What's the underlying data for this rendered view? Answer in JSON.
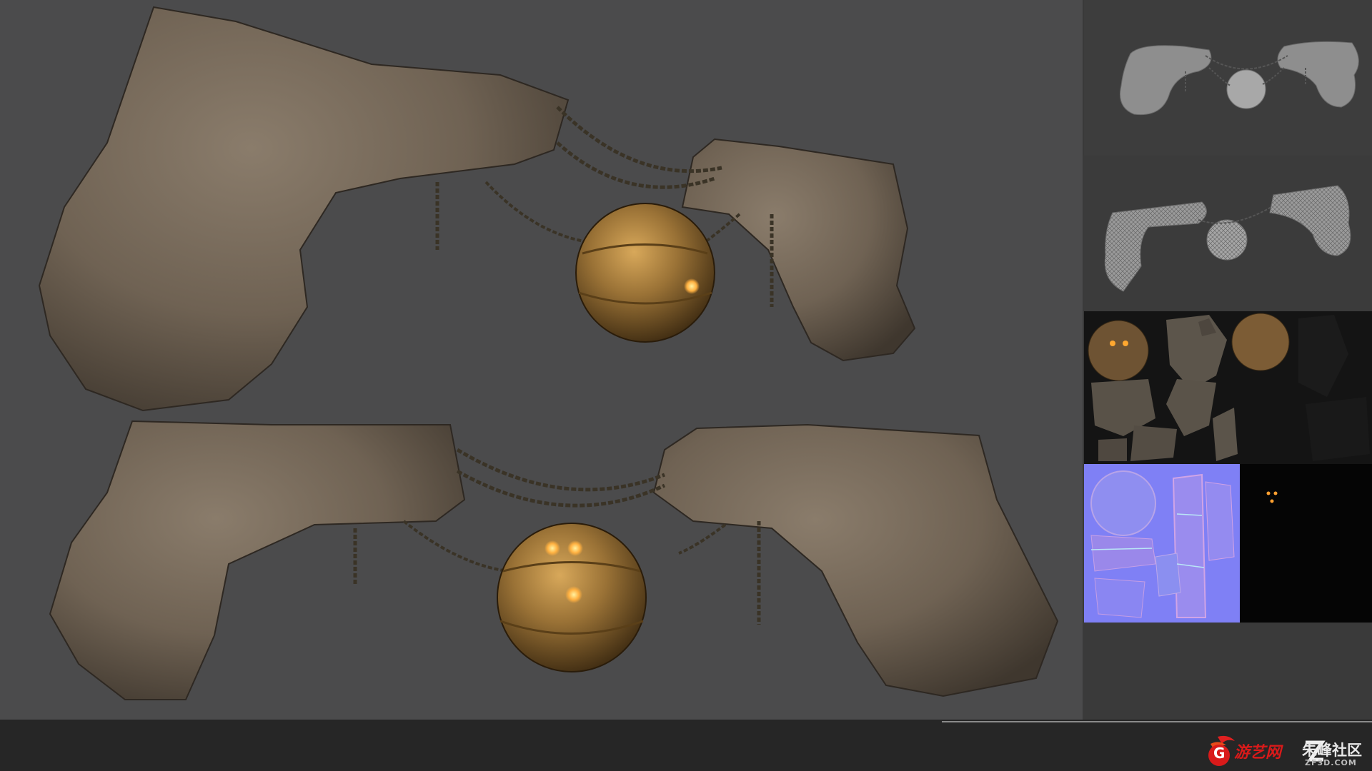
{
  "scene": {
    "viewport_background": "#4b4b4c",
    "rock_color": "#6f6253",
    "sphere_color": "#9a7236",
    "glow_color": "#ffb040",
    "chain_color": "#3a3326"
  },
  "panels": [
    {
      "name": "ao-render",
      "icon": "ao-render-thumbnail"
    },
    {
      "name": "wireframe-render",
      "icon": "wireframe-render-thumbnail"
    },
    {
      "name": "diffuse-texture",
      "icon": "diffuse-texture-atlas"
    },
    {
      "name": "normal-map",
      "icon": "normal-map-texture"
    },
    {
      "name": "emissive-map",
      "icon": "emissive-map-texture"
    }
  ],
  "watermark": {
    "logo_letter": "G",
    "site_name_1": "游艺网",
    "site_name_2": "朱峰社区",
    "url": "ZF3D.COM",
    "accent_color": "#d91a1a"
  }
}
